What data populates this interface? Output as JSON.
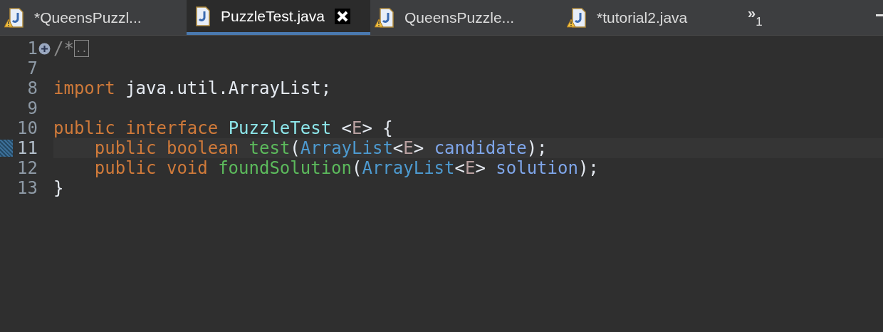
{
  "tabs": [
    {
      "label": "*QueensPuzzl...",
      "selected": false,
      "warning": true
    },
    {
      "label": "PuzzleTest.java",
      "selected": true,
      "warning": false
    },
    {
      "label": "QueensPuzzle...",
      "selected": false,
      "warning": true
    },
    {
      "label": "*tutorial2.java",
      "selected": false,
      "warning": true
    }
  ],
  "overflow": {
    "chevron": "»",
    "count": "1"
  },
  "lines": [
    {
      "number": "1",
      "folded": true,
      "current": false,
      "tokens": [
        {
          "kind": "comment",
          "text": "/*"
        },
        {
          "kind": "fold",
          "text": ".."
        }
      ]
    },
    {
      "number": "7",
      "folded": false,
      "current": false
    },
    {
      "number": "8",
      "folded": false,
      "current": false,
      "tokens": [
        {
          "kind": "keyword",
          "text": "import"
        },
        {
          "kind": "plain",
          "text": "java.util.ArrayList;",
          "spaced": true
        }
      ]
    },
    {
      "number": "9",
      "folded": false,
      "current": false
    },
    {
      "number": "10",
      "folded": false,
      "current": false,
      "tokens": [
        {
          "kind": "keyword",
          "text": "public"
        },
        {
          "kind": "keyword",
          "text": "interface",
          "spaced": true
        },
        {
          "kind": "classname",
          "text": "PuzzleTest",
          "spaced": true
        },
        {
          "kind": "plain",
          "text": "<",
          "spaced": true
        },
        {
          "kind": "typeparam",
          "text": "E"
        },
        {
          "kind": "plain",
          "text": ">"
        },
        {
          "kind": "plain",
          "text": "{",
          "spaced": true
        }
      ]
    },
    {
      "number": "11",
      "folded": false,
      "current": true,
      "indented": true,
      "tokens": [
        {
          "kind": "keyword",
          "text": "public"
        },
        {
          "kind": "keyword",
          "text": "boolean",
          "spaced": true
        },
        {
          "kind": "method",
          "text": "test",
          "spaced": true
        },
        {
          "kind": "plain",
          "text": "("
        },
        {
          "kind": "type",
          "text": "ArrayList"
        },
        {
          "kind": "plain",
          "text": "<"
        },
        {
          "kind": "typeparam",
          "text": "E"
        },
        {
          "kind": "plain",
          "text": ">"
        },
        {
          "kind": "param",
          "text": "candidate",
          "spaced": true
        },
        {
          "kind": "plain",
          "text": ");"
        }
      ]
    },
    {
      "number": "12",
      "folded": false,
      "current": false,
      "indented": true,
      "tokens": [
        {
          "kind": "keyword",
          "text": "public"
        },
        {
          "kind": "keyword",
          "text": "void",
          "spaced": true
        },
        {
          "kind": "method",
          "text": "foundSolution",
          "spaced": true
        },
        {
          "kind": "plain",
          "text": "("
        },
        {
          "kind": "type",
          "text": "ArrayList"
        },
        {
          "kind": "plain",
          "text": "<"
        },
        {
          "kind": "typeparam",
          "text": "E"
        },
        {
          "kind": "plain",
          "text": ">"
        },
        {
          "kind": "param",
          "text": "solution",
          "spaced": true
        },
        {
          "kind": "plain",
          "text": ");"
        }
      ]
    },
    {
      "number": "13",
      "folded": false,
      "current": false,
      "tokens": [
        {
          "kind": "plain",
          "text": "}"
        }
      ]
    }
  ]
}
